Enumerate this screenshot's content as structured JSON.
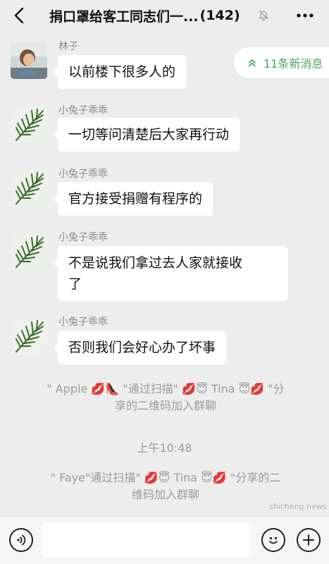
{
  "header": {
    "title": "捐口罩给客工同志们一...",
    "count": "(142)",
    "icons": {
      "back": "chevron-left-icon",
      "mute": "bell-muted-icon",
      "more": "more-dots-icon"
    }
  },
  "new_messages": {
    "label": "11条新消息",
    "icon": "double-chevron-up-icon",
    "color": "#3fa857"
  },
  "messages": [
    {
      "sender": "林子",
      "text": "以前楼下很多人的",
      "avatar": "child-photo-avatar"
    },
    {
      "sender": "小兔子乖乖",
      "text": "一切等问清楚后大家再行动",
      "avatar": "palm-leaf-avatar"
    },
    {
      "sender": "小兔子乖乖",
      "text": "官方接受捐赠有程序的",
      "avatar": "palm-leaf-avatar"
    },
    {
      "sender": "小兔子乖乖",
      "text_line1": "不是说我们拿过去人家就接收",
      "text_line2": "了",
      "avatar": "palm-leaf-avatar"
    },
    {
      "sender": "小兔子乖乖",
      "text": "否则我们会好心办了坏事",
      "avatar": "palm-leaf-avatar"
    }
  ],
  "system": [
    {
      "parts": [
        "\" Apple",
        "💋👠",
        "\"通过扫描\"",
        "💋😇",
        "Tina",
        "😇💋",
        "\"分"
      ],
      "line2": "享的二维码加入群聊"
    },
    {
      "parts": [
        "\" Faye\"通过扫描\"",
        "💋😇",
        "Tina",
        "😇💋",
        "\"分享的二"
      ],
      "line2": "维码加入群聊"
    }
  ],
  "time": "上午10:48",
  "watermark": "shicheng.news",
  "input_bar": {
    "voice_icon": "voice-icon",
    "emoji_icon": "emoji-icon",
    "plus_icon": "plus-icon",
    "placeholder": ""
  }
}
